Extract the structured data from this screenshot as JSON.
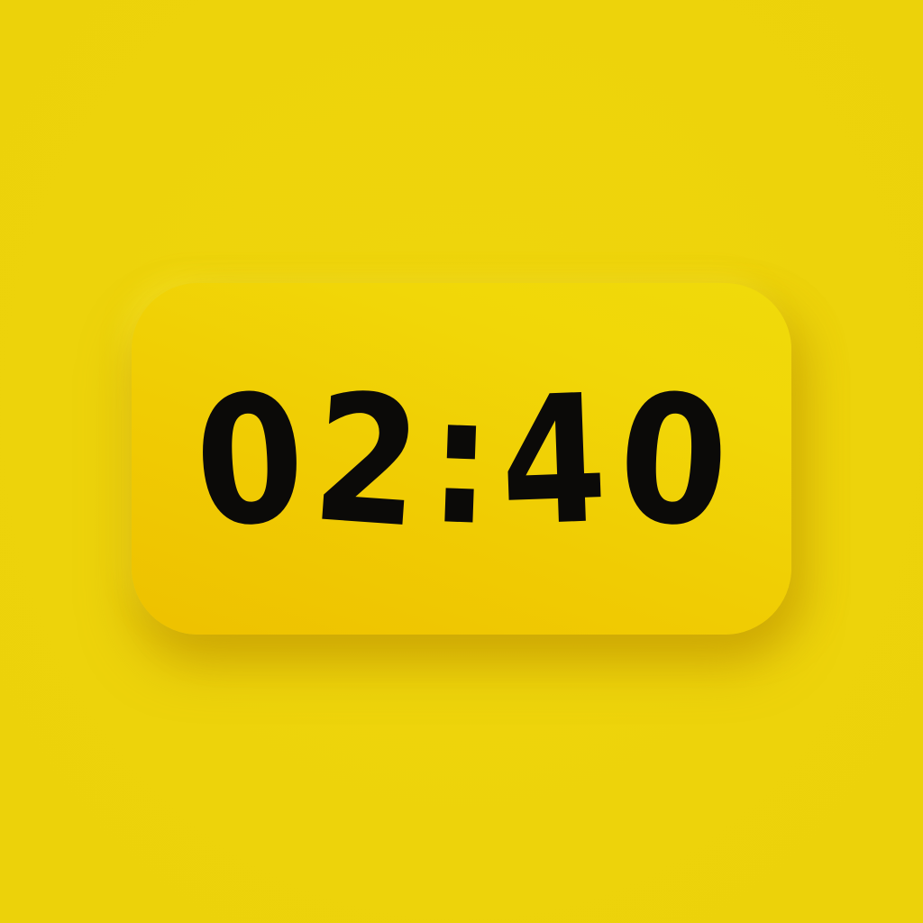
{
  "clock": {
    "time": "02:40",
    "hours": "02",
    "minutes": "40",
    "separator": ":",
    "digits": [
      "0",
      "2",
      "4",
      "0"
    ]
  },
  "colors": {
    "background": "#EDD30B",
    "card": "#F0CC03",
    "text": "#0B0A08"
  }
}
